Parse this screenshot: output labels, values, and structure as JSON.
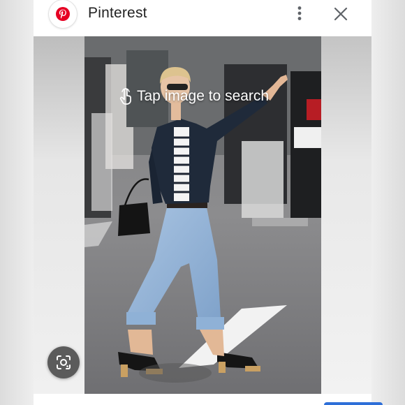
{
  "header": {
    "app_title": "Pinterest",
    "brand_color": "#e60023",
    "logo_icon": "pinterest-logo",
    "menu_icon": "more-vert-icon",
    "close_icon": "close-icon"
  },
  "overlay": {
    "hint_text": "Tap image to search",
    "hint_icon": "tap-hand-icon"
  },
  "lens_button": {
    "icon": "google-lens-icon"
  },
  "colors": {
    "fab_background": "#5b5b5b",
    "accent_blue": "#2e6fd8"
  }
}
